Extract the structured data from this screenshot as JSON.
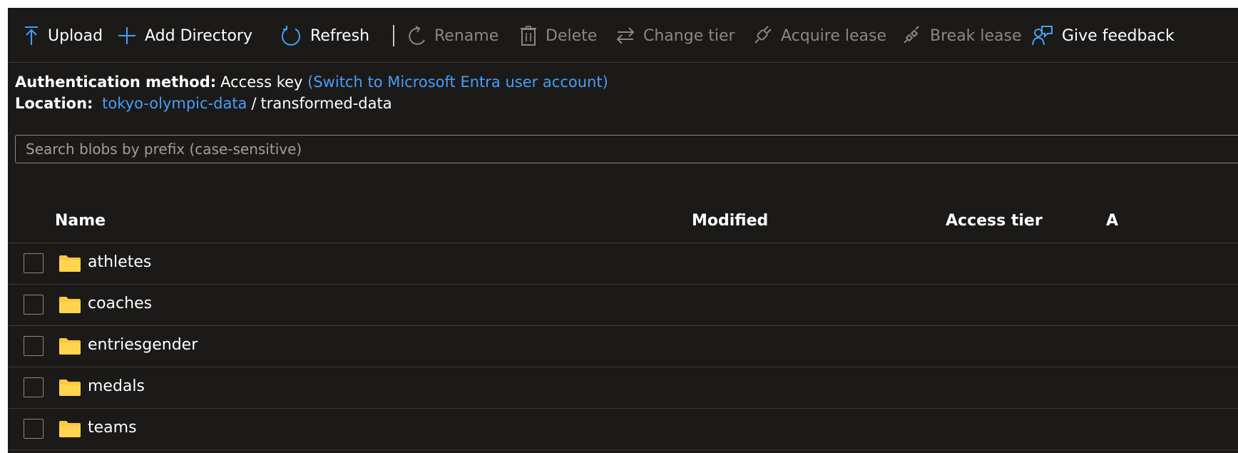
{
  "toolbar": {
    "upload_label": "Upload",
    "add_directory_label": "Add Directory",
    "refresh_label": "Refresh",
    "rename_label": "Rename",
    "delete_label": "Delete",
    "change_tier_label": "Change tier",
    "acquire_lease_label": "Acquire lease",
    "break_lease_label": "Break lease",
    "give_feedback_label": "Give feedback"
  },
  "auth": {
    "label": "Authentication method:",
    "value": "Access key",
    "switch_link": "(Switch to Microsoft Entra user account)"
  },
  "location": {
    "label": "Location:",
    "container": "tokyo-olympic-data",
    "separator": "/",
    "folder": "transformed-data"
  },
  "search": {
    "placeholder": "Search blobs by prefix (case-sensitive)",
    "value": ""
  },
  "table": {
    "columns": {
      "name": "Name",
      "modified": "Modified",
      "access_tier": "Access tier",
      "next_truncated": "A"
    },
    "rows": [
      {
        "name": "athletes"
      },
      {
        "name": "coaches"
      },
      {
        "name": "entriesgender"
      },
      {
        "name": "medals"
      },
      {
        "name": "teams"
      }
    ]
  },
  "colors": {
    "background": "#1b1a19",
    "text": "#ffffff",
    "disabled_text": "#8a8886",
    "link": "#479ef5",
    "icon_accent": "#479ef5",
    "folder": "#ffc83d",
    "divider": "#3b3a39"
  },
  "icons": {
    "upload": "upload-icon",
    "add_directory": "plus-icon",
    "refresh": "refresh-icon",
    "rename": "rename-icon",
    "delete": "trash-icon",
    "change_tier": "swap-arrows-icon",
    "acquire_lease": "plug-icon",
    "break_lease": "broken-plug-icon",
    "give_feedback": "feedback-person-icon",
    "folder": "folder-icon"
  }
}
